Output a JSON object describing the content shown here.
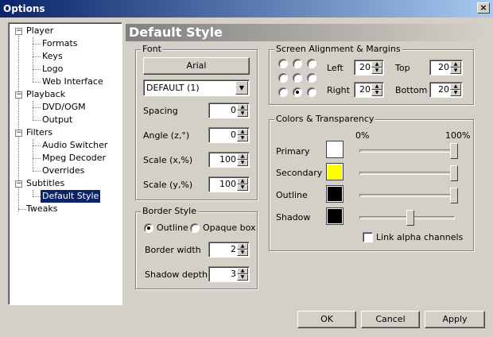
{
  "window": {
    "title": "Options",
    "close_glyph": "×"
  },
  "tree": {
    "expanders": [
      "−",
      "−",
      "−",
      "−"
    ],
    "items": [
      {
        "label": "Player"
      },
      {
        "label": "Formats"
      },
      {
        "label": "Keys"
      },
      {
        "label": "Logo"
      },
      {
        "label": "Web Interface"
      },
      {
        "label": "Playback"
      },
      {
        "label": "DVD/OGM"
      },
      {
        "label": "Output"
      },
      {
        "label": "Filters"
      },
      {
        "label": "Audio Switcher"
      },
      {
        "label": "Mpeg Decoder"
      },
      {
        "label": "Overrides"
      },
      {
        "label": "Subtitles"
      },
      {
        "label": "Default Style"
      },
      {
        "label": "Tweaks"
      }
    ],
    "selected": "Default Style"
  },
  "header": {
    "title": "Default Style"
  },
  "font_group": {
    "title": "Font",
    "font_button": "Arial",
    "charset": "DEFAULT (1)",
    "fields": [
      {
        "label": "Spacing",
        "value": "0"
      },
      {
        "label": "Angle (z,°)",
        "value": "0"
      },
      {
        "label": "Scale (x,%)",
        "value": "100"
      },
      {
        "label": "Scale (y,%)",
        "value": "100"
      }
    ]
  },
  "border_group": {
    "title": "Border Style",
    "outline_label": "Outline",
    "opaque_label": "Opaque box",
    "selected": "Outline",
    "fields": [
      {
        "label": "Border width",
        "value": "2"
      },
      {
        "label": "Shadow depth",
        "value": "3"
      }
    ]
  },
  "alignment_group": {
    "title": "Screen Alignment & Margins",
    "selected_position": "bottom-center",
    "margins": [
      {
        "label": "Left",
        "value": "20"
      },
      {
        "label": "Top",
        "value": "20"
      },
      {
        "label": "Right",
        "value": "20"
      },
      {
        "label": "Bottom",
        "value": "20"
      }
    ]
  },
  "colors_group": {
    "title": "Colors & Transparency",
    "min_label": "0%",
    "max_label": "100%",
    "rows": [
      {
        "label": "Primary",
        "color": "#ffffff",
        "alpha": 1.0
      },
      {
        "label": "Secondary",
        "color": "#ffff00",
        "alpha": 1.0
      },
      {
        "label": "Outline",
        "color": "#000000",
        "alpha": 1.0
      },
      {
        "label": "Shadow",
        "color": "#000000",
        "alpha": 0.5
      }
    ],
    "link_alpha_label": "Link alpha channels",
    "link_alpha_checked": false
  },
  "footer": {
    "ok": "OK",
    "cancel": "Cancel",
    "apply": "Apply"
  }
}
